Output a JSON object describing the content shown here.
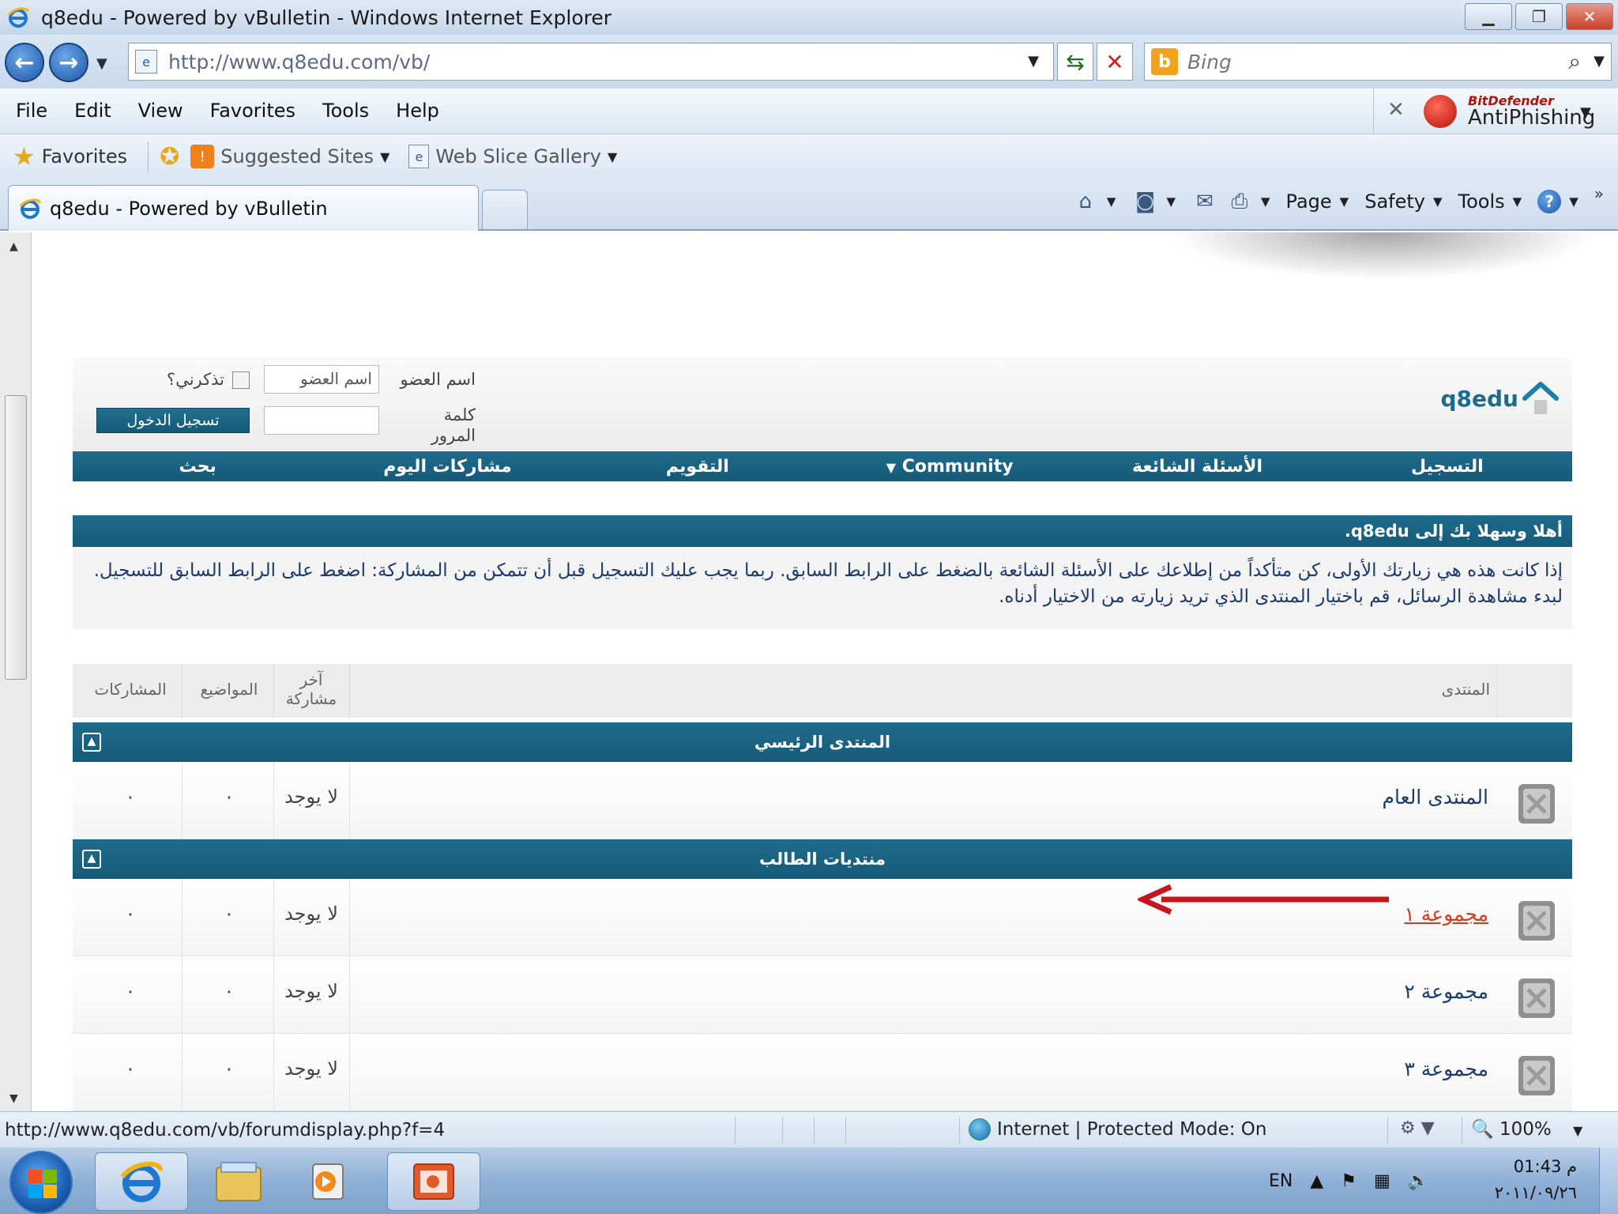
{
  "window": {
    "title": "q8edu - Powered by vBulletin - Windows Internet Explorer"
  },
  "address": {
    "url": "http://www.q8edu.com/vb/",
    "search_placeholder": "Bing"
  },
  "menu": {
    "items": [
      "File",
      "Edit",
      "View",
      "Favorites",
      "Tools",
      "Help"
    ],
    "toolbar_brand": "BitDefender",
    "toolbar_product": "AntiPhishing"
  },
  "favorites_bar": {
    "favorites_label": "Favorites",
    "suggested_sites": "Suggested Sites",
    "web_slice_gallery": "Web Slice Gallery"
  },
  "tabs": {
    "active_tab": "q8edu - Powered by vBulletin"
  },
  "command_bar": {
    "page": "Page",
    "safety": "Safety",
    "tools": "Tools"
  },
  "site": {
    "logo": "q8edu",
    "login": {
      "username_label": "اسم العضو",
      "username_value": "اسم العضو",
      "remember_label": "تذكرني؟",
      "password_label": "كلمة المرور",
      "login_button": "تسجيل الدخول"
    },
    "nav": [
      "التسجيل",
      "الأسئلة الشائعة",
      "Community",
      "التقويم",
      "مشاركات اليوم",
      "بحث"
    ],
    "welcome_title": "أهلا وسهلا بك إلى q8edu.",
    "welcome_text": "إذا كانت هذه هي زيارتك الأولى، كن متأكداً من إطلاعك على الأسئلة الشائعة بالضغط على الرابط السابق. ربما يجب عليك التسجيل قبل أن تتمكن من المشاركة: اضغط على الرابط السابق للتسجيل. لبدء مشاهدة الرسائل، قم باختيار المنتدى الذي تريد زيارته من الاختيار أدناه.",
    "table_headers": {
      "forum": "المنتدى",
      "last_post": "آخر مشاركة",
      "topics": "المواضيع",
      "posts": "المشاركات"
    },
    "categories": [
      {
        "title": "المنتدى الرئيسي",
        "forums": [
          {
            "name": "المنتدى العام",
            "last_post": "لا يوجد",
            "topics": "٠",
            "posts": "٠"
          }
        ]
      },
      {
        "title": "منتديات الطالب",
        "forums": [
          {
            "name": "مجموعة ١",
            "last_post": "لا يوجد",
            "topics": "٠",
            "posts": "٠",
            "highlighted": true
          },
          {
            "name": "مجموعة ٢",
            "last_post": "لا يوجد",
            "topics": "٠",
            "posts": "٠"
          },
          {
            "name": "مجموعة ٣",
            "last_post": "لا يوجد",
            "topics": "٠",
            "posts": "٠"
          }
        ]
      }
    ]
  },
  "status_bar": {
    "url": "http://www.q8edu.com/vb/forumdisplay.php?f=4",
    "zone": "Internet | Protected Mode: On",
    "zoom": "100%"
  },
  "taskbar": {
    "language": "EN",
    "time": "01:43 م",
    "date": "٢٠١١/٠٩/٢٦"
  },
  "colors": {
    "forum_blue": "#1f6b8c",
    "highlight_red": "#d63b1b",
    "arrow_red": "#c4161c"
  }
}
